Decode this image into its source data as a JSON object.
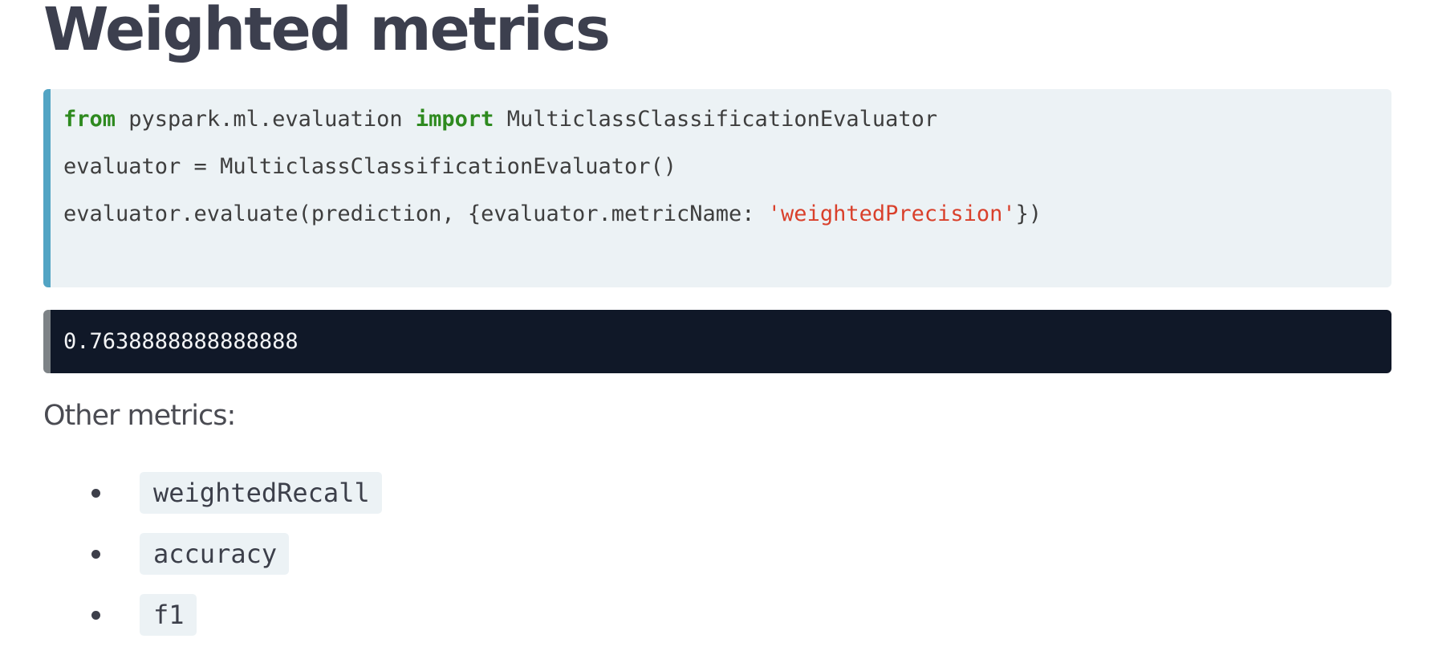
{
  "heading": "Weighted metrics",
  "code": {
    "line1": {
      "kw_from": "from",
      "module": " pyspark.ml.evaluation ",
      "kw_import": "import",
      "name": " MulticlassClassificationEvaluator"
    },
    "line2": "evaluator = MulticlassClassificationEvaluator()",
    "line3": {
      "prefix": "evaluator.evaluate(prediction, {evaluator.metricName: ",
      "string": "'weightedPrecision'",
      "suffix": "})"
    }
  },
  "output": "0.7638888888888888",
  "paragraph": "Other metrics:",
  "metrics": [
    "weightedRecall",
    "accuracy",
    "f1"
  ],
  "colors": {
    "keyword": "#2e8a1f",
    "string": "#d9402b",
    "code_border": "#52a4c4",
    "output_bg": "#101828"
  }
}
